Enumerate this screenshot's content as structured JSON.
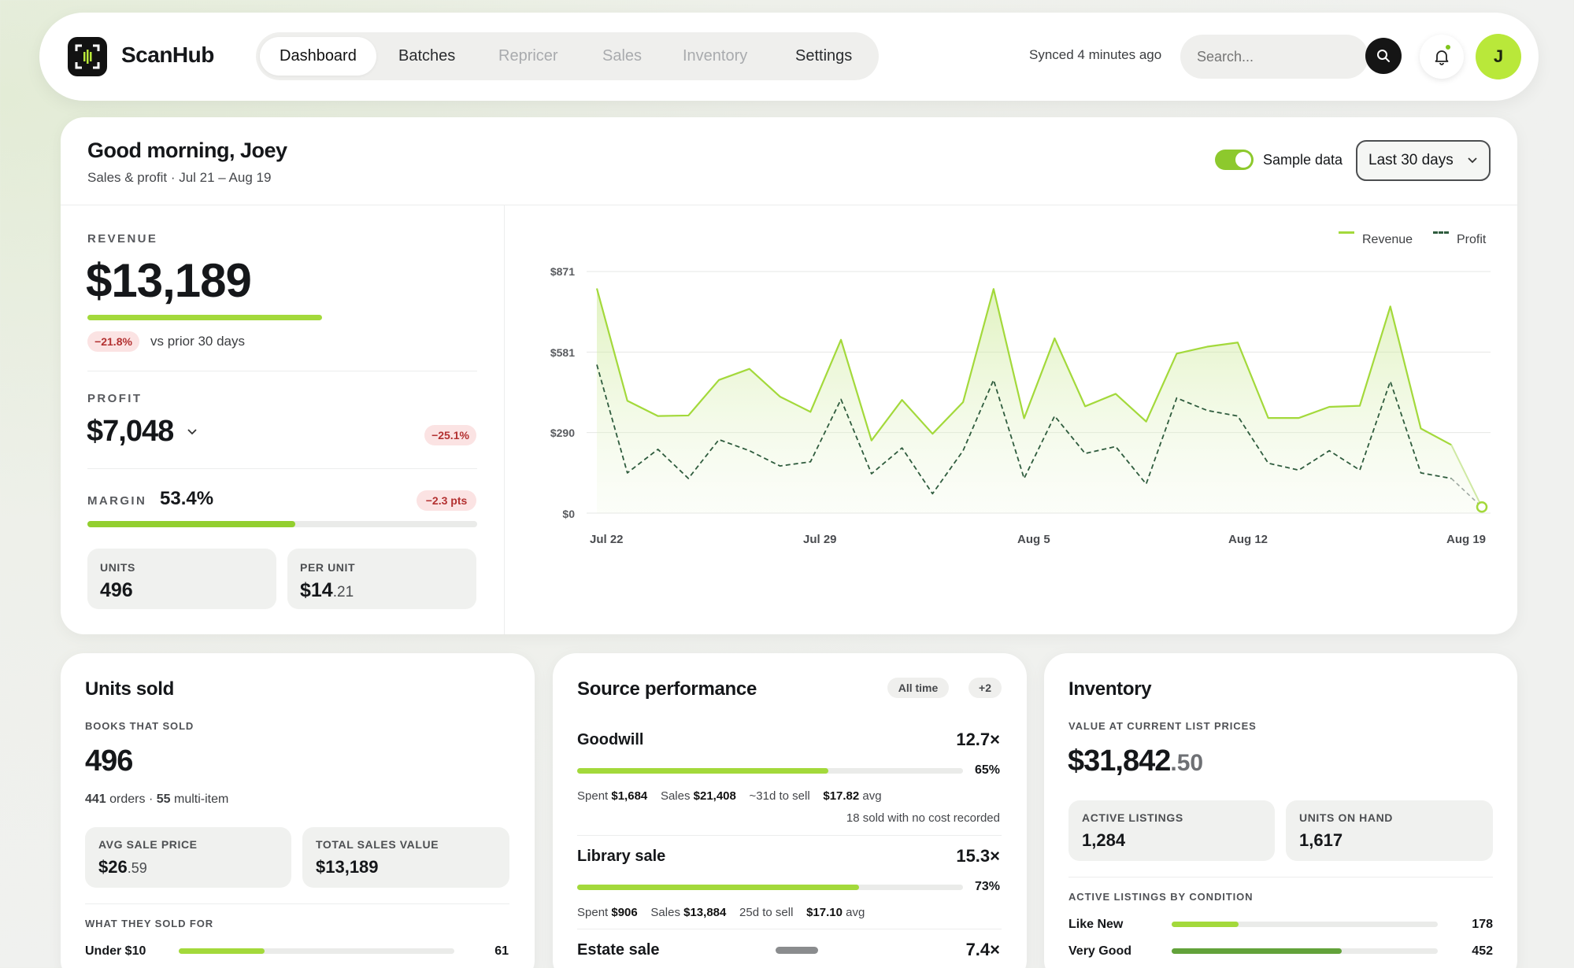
{
  "app": {
    "name": "ScanHub"
  },
  "nav": {
    "tabs": [
      {
        "label": "Dashboard"
      },
      {
        "label": "Batches"
      },
      {
        "label": "Repricer"
      },
      {
        "label": "Sales"
      },
      {
        "label": "Inventory"
      },
      {
        "label": "Settings"
      }
    ]
  },
  "header": {
    "synced": "Synced 4 minutes ago",
    "search_placeholder": "Search...",
    "avatar_initial": "J"
  },
  "overview": {
    "greeting": "Good morning, Joey",
    "subtitle": "Sales & profit · Jul 21 – Aug 19",
    "sample_label": "Sample data",
    "sample_on": true,
    "range": "Last 30 days"
  },
  "revenue": {
    "label": "REVENUE",
    "value": "$13,189",
    "bar_fraction": 0.6,
    "change": "−21.8%",
    "compare": "vs prior 30 days"
  },
  "profit": {
    "label": "PROFIT",
    "value": "$7,048",
    "change": "−25.1%"
  },
  "margin": {
    "label": "MARGIN",
    "value": "53.4%",
    "change": "−2.3 pts",
    "fraction": 0.534
  },
  "units_tile": {
    "label": "UNITS",
    "value": "496"
  },
  "per_unit_tile": {
    "label": "PER UNIT",
    "value_main": "$14",
    "value_cents": ".21"
  },
  "chart_data": {
    "type": "line",
    "legend": [
      "Revenue",
      "Profit"
    ],
    "yticks": [
      "$871",
      "$581",
      "$290",
      "$0"
    ],
    "ylim": [
      0,
      871
    ],
    "xticks": [
      "Jul 22",
      "Jul 29",
      "Aug 5",
      "Aug 12",
      "Aug 19"
    ],
    "x": [
      "Jul 21",
      "Jul 22",
      "Jul 23",
      "Jul 24",
      "Jul 25",
      "Jul 26",
      "Jul 27",
      "Jul 28",
      "Jul 29",
      "Jul 30",
      "Jul 31",
      "Aug 1",
      "Aug 2",
      "Aug 3",
      "Aug 4",
      "Aug 5",
      "Aug 6",
      "Aug 7",
      "Aug 8",
      "Aug 9",
      "Aug 10",
      "Aug 11",
      "Aug 12",
      "Aug 13",
      "Aug 14",
      "Aug 15",
      "Aug 16",
      "Aug 17",
      "Aug 18",
      "Aug 19"
    ],
    "series": [
      {
        "name": "Revenue",
        "values": [
          810,
          405,
          350,
          352,
          480,
          520,
          420,
          365,
          625,
          262,
          408,
          286,
          400,
          808,
          342,
          630,
          385,
          430,
          330,
          575,
          600,
          615,
          343,
          343,
          383,
          387,
          745,
          305,
          246,
          22
        ]
      },
      {
        "name": "Profit",
        "values": [
          535,
          145,
          230,
          125,
          265,
          225,
          170,
          185,
          410,
          142,
          235,
          70,
          225,
          480,
          125,
          350,
          215,
          240,
          105,
          415,
          370,
          350,
          180,
          155,
          225,
          155,
          475,
          145,
          125,
          22
        ]
      }
    ]
  },
  "units_sold": {
    "title": "Units sold",
    "section": "BOOKS THAT SOLD",
    "value": "496",
    "orders_num": "441",
    "orders_text": "orders ·",
    "multi_num": "55",
    "multi_text": "multi-item",
    "avg_label": "AVG SALE PRICE",
    "avg_main": "$26",
    "avg_cents": ".59",
    "total_label": "TOTAL SALES VALUE",
    "total_value": "$13,189",
    "sold_for_label": "WHAT THEY SOLD FOR",
    "bucket_label": "Under $10",
    "bucket_value": "61",
    "bucket_fraction": 0.31
  },
  "source_performance": {
    "title": "Source performance",
    "chip_range": "All time",
    "chip_more": "+2",
    "sources": [
      {
        "name": "Goodwill",
        "multiple": "12.7×",
        "pct": "65%",
        "fraction": 0.65,
        "spent": "$1,684",
        "sales": "$21,408",
        "sell_time": "~31d to sell",
        "avg": "$17.82",
        "note": "18 sold with no cost recorded"
      },
      {
        "name": "Library sale",
        "multiple": "15.3×",
        "pct": "73%",
        "fraction": 0.73,
        "spent": "$906",
        "sales": "$13,884",
        "sell_time": "25d to sell",
        "avg": "$17.10"
      },
      {
        "name": "Estate sale",
        "multiple": "7.4×"
      }
    ],
    "spent_label": "Spent",
    "sales_label": "Sales",
    "avg_suffix": "avg"
  },
  "inventory": {
    "title": "Inventory",
    "section": "VALUE AT CURRENT LIST PRICES",
    "value_main": "$31,842",
    "value_cents": ".50",
    "active_label": "ACTIVE LISTINGS",
    "active_value": "1,284",
    "onhand_label": "UNITS ON HAND",
    "onhand_value": "1,617",
    "condition_label": "ACTIVE LISTINGS BY CONDITION",
    "conditions": [
      {
        "name": "Like New",
        "value": "178",
        "fraction": 0.25
      },
      {
        "name": "Very Good",
        "value": "452",
        "fraction": 0.64
      }
    ]
  },
  "colors": {
    "accent": "#a3d93b",
    "accent_dark": "#6aa321",
    "profit": "#2f5c3e",
    "negative": "#b33131"
  }
}
